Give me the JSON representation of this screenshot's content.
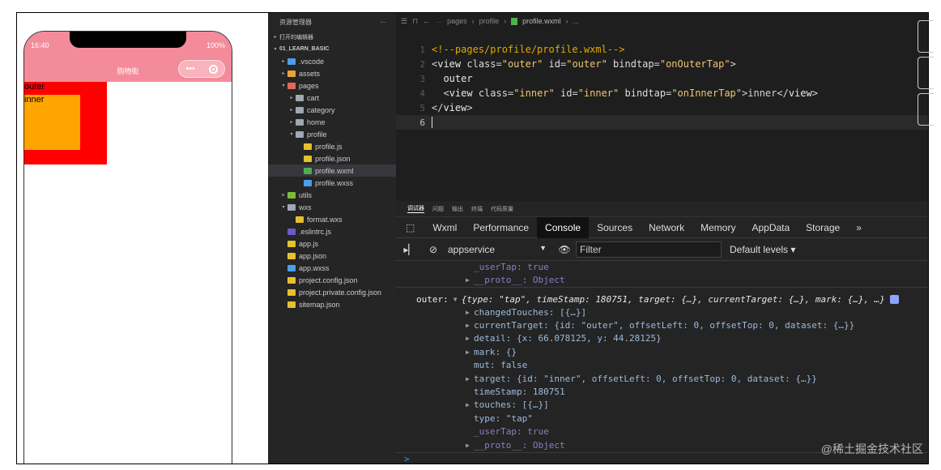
{
  "simulator": {
    "status_time": "16:40",
    "battery": "100%",
    "nav_title": "购物街",
    "capsule_more": "•••",
    "outer_text": "outer",
    "inner_text": "inner",
    "colors": {
      "navbar": "#f48b9a",
      "outer": "#ff0000",
      "inner": "#ffa500"
    }
  },
  "explorer": {
    "title": "资源管理器",
    "more": "···",
    "sections": [
      "打开的编辑器",
      "01_LEARN_BASIC"
    ],
    "items": [
      {
        "label": ".vscode",
        "icon": "folder-icon"
      },
      {
        "label": "assets",
        "icon": "folder-icon"
      },
      {
        "label": "pages",
        "icon": "folder-open-icon"
      },
      {
        "label": "cart",
        "icon": "folder-icon"
      },
      {
        "label": "category",
        "icon": "folder-icon"
      },
      {
        "label": "home",
        "icon": "folder-icon"
      },
      {
        "label": "profile",
        "icon": "folder-open-icon"
      },
      {
        "label": "profile.js",
        "icon": "js-file-icon"
      },
      {
        "label": "profile.json",
        "icon": "json-file-icon"
      },
      {
        "label": "profile.wxml",
        "icon": "wxml-file-icon"
      },
      {
        "label": "profile.wxss",
        "icon": "wxss-file-icon"
      },
      {
        "label": "utils",
        "icon": "folder-icon"
      },
      {
        "label": "wxs",
        "icon": "folder-open-icon"
      },
      {
        "label": "format.wxs",
        "icon": "js-file-icon"
      },
      {
        "label": ".eslintrc.js",
        "icon": "eslint-file-icon"
      },
      {
        "label": "app.js",
        "icon": "js-file-icon"
      },
      {
        "label": "app.json",
        "icon": "json-file-icon"
      },
      {
        "label": "app.wxss",
        "icon": "wxss-file-icon"
      },
      {
        "label": "project.config.json",
        "icon": "json-file-icon"
      },
      {
        "label": "project.private.config.json",
        "icon": "json-file-icon"
      },
      {
        "label": "sitemap.json",
        "icon": "json-file-icon"
      }
    ]
  },
  "editor": {
    "breadcrumb": [
      "pages",
      "profile",
      "profile.wxml",
      "..."
    ],
    "lines": [
      {
        "num": "1",
        "html": "<span style=\"color:#e0a800\">&lt;!--pages/profile/profile.wxml--&gt;</span>"
      },
      {
        "num": "2",
        "html": "<span style=\"color:#d4d4d4\">&lt;</span><span style=\"color:#e8e8e8\">view</span> <span style=\"color:#dcdcdc\">class</span>=<span style=\"color:#f0c674\">\"outer\"</span> <span style=\"color:#dcdcdc\">id</span>=<span style=\"color:#f0c674\">\"outer\"</span> <span style=\"color:#dcdcdc\">bindtap</span>=<span style=\"color:#f0c674\">\"onOuterTap\"</span>&gt;"
      },
      {
        "num": "3",
        "html": "  <span style=\"color:#e8e8e8\">outer</span>"
      },
      {
        "num": "4",
        "html": "  &lt;<span style=\"color:#e8e8e8\">view</span> <span style=\"color:#dcdcdc\">class</span>=<span style=\"color:#f0c674\">\"inner\"</span> <span style=\"color:#dcdcdc\">id</span>=<span style=\"color:#f0c674\">\"inner\"</span> <span style=\"color:#dcdcdc\">bindtap</span>=<span style=\"color:#f0c674\">\"onInnerTap\"</span>&gt;inner&lt;/<span style=\"color:#e8e8e8\">view</span>&gt;"
      },
      {
        "num": "5",
        "html": "&lt;/<span style=\"color:#e8e8e8\">view</span>&gt;"
      },
      {
        "num": "6",
        "html": ""
      }
    ]
  },
  "devtools": {
    "top_tabs": [
      "调试器",
      "问题",
      "输出",
      "终端",
      "代码质量"
    ],
    "tabs": [
      "Wxml",
      "Performance",
      "Console",
      "Sources",
      "Network",
      "Memory",
      "AppData",
      "Storage"
    ],
    "more_tabs": "»",
    "context": "appservice",
    "filter_placeholder": "Filter",
    "levels": "Default levels ▾"
  },
  "console_lines": [
    "_userTap: true",
    "__proto__: Object",
    "outer:",
    "{type: \"tap\", timeStamp: 180751, target: {…}, currentTarget: {…}, mark: {…}, …}",
    "changedTouches: [{…}]",
    "currentTarget: {id: \"outer\", offsetLeft: 0, offsetTop: 0, dataset: {…}}",
    "detail: {x: 66.078125, y: 44.28125}",
    "mark: {}",
    "mut: false",
    "target: {id: \"inner\", offsetLeft: 0, offsetTop: 0, dataset: {…}}",
    "timeStamp: 180751",
    "touches: [{…}]",
    "type: \"tap\"",
    "_userTap: true",
    "__proto__: Object",
    ">"
  ],
  "watermark": "@稀土掘金技术社区"
}
